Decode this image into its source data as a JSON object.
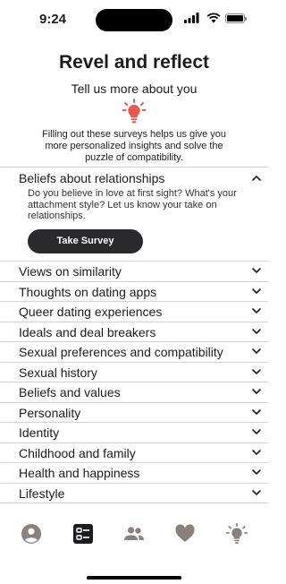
{
  "status": {
    "time": "9:24"
  },
  "header": {
    "title": "Revel and reflect",
    "subtitle": "Tell us more about you",
    "description": "Filling out these surveys helps us give you more personalized insights and solve the puzzle of compatibility."
  },
  "colors": {
    "accent": "#e8584e",
    "tab_inactive": "#8a817c",
    "tab_active": "#1c1c1e",
    "button_bg": "#2a2a2c"
  },
  "survey_open": {
    "label": "Beliefs about relationships",
    "body": "Do you believe in love at first sight? What's your attachment style? Let us know your take on relationships.",
    "button": "Take Survey"
  },
  "surveys": [
    {
      "label": "Views on similarity"
    },
    {
      "label": "Thoughts on dating apps"
    },
    {
      "label": "Queer dating experiences"
    },
    {
      "label": "Ideals and deal breakers"
    },
    {
      "label": "Sexual preferences and compatibility"
    },
    {
      "label": "Sexual history"
    },
    {
      "label": "Beliefs and values"
    },
    {
      "label": "Personality"
    },
    {
      "label": "Identity"
    },
    {
      "label": "Childhood and family"
    },
    {
      "label": "Health and happiness"
    },
    {
      "label": "Lifestyle"
    }
  ],
  "tabs": [
    {
      "icon": "profile-icon"
    },
    {
      "icon": "surveys-icon",
      "active": true
    },
    {
      "icon": "people-icon"
    },
    {
      "icon": "heart-icon"
    },
    {
      "icon": "lightbulb-icon"
    }
  ]
}
